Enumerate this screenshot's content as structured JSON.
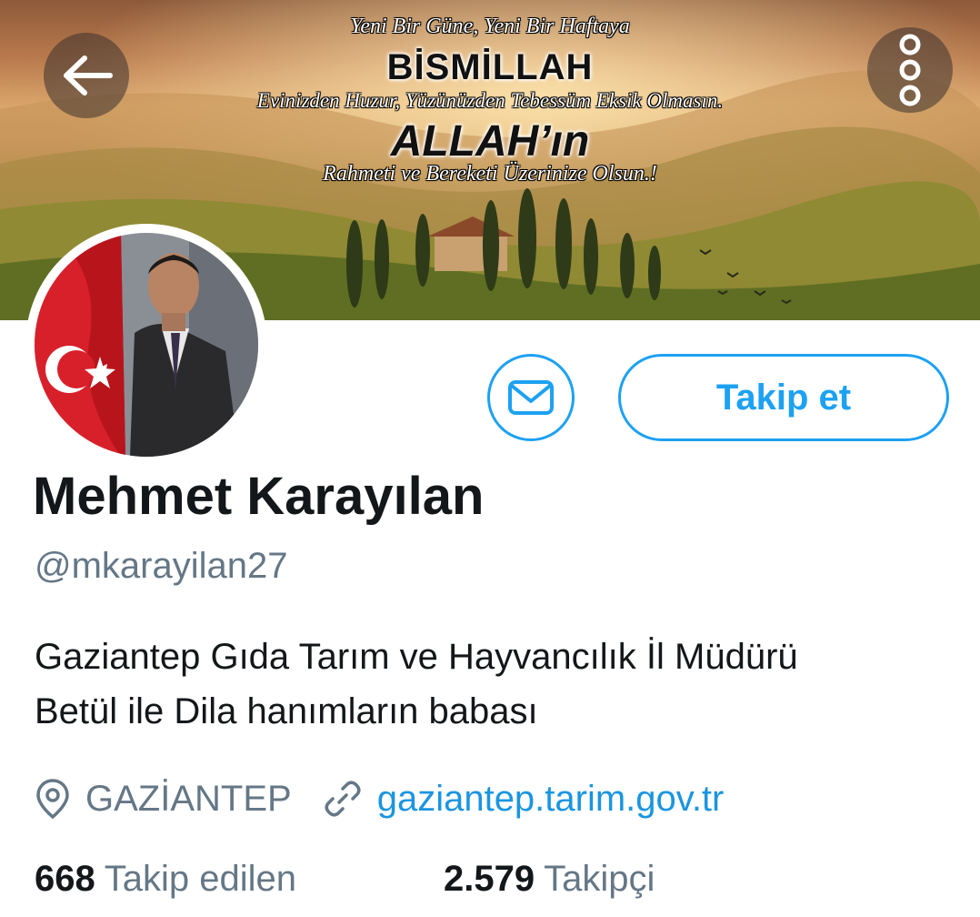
{
  "banner": {
    "line1": "Yeni Bir Güne,  Yeni Bir Haftaya",
    "line2": "BİSMİLLAH",
    "line3": "Evinizden Huzur, Yüzünüzden Tebessüm Eksik Olmasın.",
    "line4": "ALLAH’ın",
    "line5": "Rahmeti ve Bereketi  Üzerinize Olsun.!"
  },
  "nav": {
    "back_icon": "arrow-left-icon",
    "more_icon": "more-vertical-icon"
  },
  "profile": {
    "name": "Mehmet Karayılan",
    "handle": "@mkarayilan27",
    "bio_lines": [
      "Gaziantep Gıda Tarım ve Hayvancılık İl Müdürü",
      "Betül ile Dila hanımların babası"
    ],
    "location": "GAZİANTEP",
    "website": "gaziantep.tarim.gov.tr"
  },
  "actions": {
    "message_icon": "mail-icon",
    "follow_label": "Takip et"
  },
  "stats": {
    "following_count": "668",
    "following_label": "Takip edilen",
    "followers_count": "2.579",
    "followers_label": "Takipçi"
  },
  "colors": {
    "accent": "#1da1f2",
    "link": "#1b95e0",
    "secondary_text": "#657786",
    "primary_text": "#14171a"
  }
}
